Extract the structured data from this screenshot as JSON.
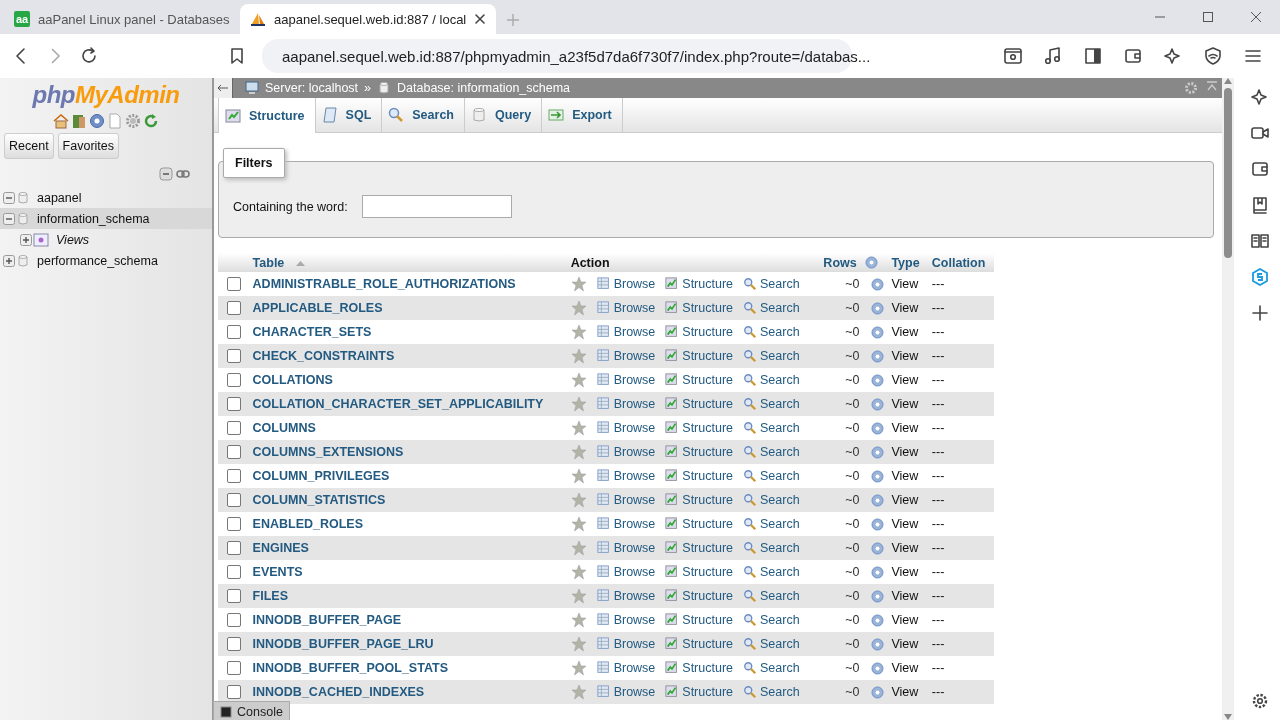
{
  "browser": {
    "tabs": [
      {
        "title": "aaPanel Linux panel - Databases",
        "icon_text": "aa",
        "selected": false
      },
      {
        "title": "aapanel.sequel.web.id:887 / local",
        "selected": true
      }
    ],
    "address": "aapanel.sequel.web.id:887/phpmyadmin_a23f5d7da6f730f7/index.php?route=/databas..."
  },
  "nav": {
    "logo": [
      "php",
      "MyAdmin"
    ],
    "tabs": [
      {
        "label": "Recent"
      },
      {
        "label": "Favorites"
      }
    ],
    "tree": [
      {
        "label": "aapanel",
        "expanded": true,
        "selected": false,
        "italic": false
      },
      {
        "label": "information_schema",
        "expanded": true,
        "selected": true,
        "italic": false,
        "children": [
          {
            "label": "Views",
            "expanded": false,
            "selected": false,
            "italic": true
          }
        ]
      },
      {
        "label": "performance_schema",
        "expanded": false,
        "selected": false,
        "italic": false
      }
    ]
  },
  "breadcrumb": {
    "server": "Server: localhost",
    "separator": "»",
    "database": "Database: information_schema"
  },
  "tabs": [
    {
      "label": "Structure",
      "selected": true
    },
    {
      "label": "SQL",
      "selected": false
    },
    {
      "label": "Search",
      "selected": false
    },
    {
      "label": "Query",
      "selected": false
    },
    {
      "label": "Export",
      "selected": false
    }
  ],
  "filters": {
    "legend": "Filters",
    "label": "Containing the word:"
  },
  "table": {
    "columns": [
      "Table",
      "Action",
      "Rows",
      "Type",
      "Collation"
    ],
    "rows": [
      {
        "name": "ADMINISTRABLE_ROLE_AUTHORIZATIONS",
        "checked": false,
        "favorite": false,
        "actions": [
          "Browse",
          "Structure",
          "Search"
        ],
        "rows": "~0",
        "type": "View",
        "collation": "---"
      },
      {
        "name": "APPLICABLE_ROLES",
        "checked": false,
        "favorite": false,
        "actions": [
          "Browse",
          "Structure",
          "Search"
        ],
        "rows": "~0",
        "type": "View",
        "collation": "---"
      },
      {
        "name": "CHARACTER_SETS",
        "checked": false,
        "favorite": false,
        "actions": [
          "Browse",
          "Structure",
          "Search"
        ],
        "rows": "~0",
        "type": "View",
        "collation": "---"
      },
      {
        "name": "CHECK_CONSTRAINTS",
        "checked": false,
        "favorite": false,
        "actions": [
          "Browse",
          "Structure",
          "Search"
        ],
        "rows": "~0",
        "type": "View",
        "collation": "---"
      },
      {
        "name": "COLLATIONS",
        "checked": false,
        "favorite": false,
        "actions": [
          "Browse",
          "Structure",
          "Search"
        ],
        "rows": "~0",
        "type": "View",
        "collation": "---"
      },
      {
        "name": "COLLATION_CHARACTER_SET_APPLICABILITY",
        "checked": false,
        "favorite": false,
        "actions": [
          "Browse",
          "Structure",
          "Search"
        ],
        "rows": "~0",
        "type": "View",
        "collation": "---"
      },
      {
        "name": "COLUMNS",
        "checked": false,
        "favorite": false,
        "actions": [
          "Browse",
          "Structure",
          "Search"
        ],
        "rows": "~0",
        "type": "View",
        "collation": "---"
      },
      {
        "name": "COLUMNS_EXTENSIONS",
        "checked": false,
        "favorite": false,
        "actions": [
          "Browse",
          "Structure",
          "Search"
        ],
        "rows": "~0",
        "type": "View",
        "collation": "---"
      },
      {
        "name": "COLUMN_PRIVILEGES",
        "checked": false,
        "favorite": false,
        "actions": [
          "Browse",
          "Structure",
          "Search"
        ],
        "rows": "~0",
        "type": "View",
        "collation": "---"
      },
      {
        "name": "COLUMN_STATISTICS",
        "checked": false,
        "favorite": false,
        "actions": [
          "Browse",
          "Structure",
          "Search"
        ],
        "rows": "~0",
        "type": "View",
        "collation": "---"
      },
      {
        "name": "ENABLED_ROLES",
        "checked": false,
        "favorite": false,
        "actions": [
          "Browse",
          "Structure",
          "Search"
        ],
        "rows": "~0",
        "type": "View",
        "collation": "---"
      },
      {
        "name": "ENGINES",
        "checked": false,
        "favorite": false,
        "actions": [
          "Browse",
          "Structure",
          "Search"
        ],
        "rows": "~0",
        "type": "View",
        "collation": "---"
      },
      {
        "name": "EVENTS",
        "checked": false,
        "favorite": false,
        "actions": [
          "Browse",
          "Structure",
          "Search"
        ],
        "rows": "~0",
        "type": "View",
        "collation": "---"
      },
      {
        "name": "FILES",
        "checked": false,
        "favorite": false,
        "actions": [
          "Browse",
          "Structure",
          "Search"
        ],
        "rows": "~0",
        "type": "View",
        "collation": "---"
      },
      {
        "name": "INNODB_BUFFER_PAGE",
        "checked": false,
        "favorite": false,
        "actions": [
          "Browse",
          "Structure",
          "Search"
        ],
        "rows": "~0",
        "type": "View",
        "collation": "---"
      },
      {
        "name": "INNODB_BUFFER_PAGE_LRU",
        "checked": false,
        "favorite": false,
        "actions": [
          "Browse",
          "Structure",
          "Search"
        ],
        "rows": "~0",
        "type": "View",
        "collation": "---"
      },
      {
        "name": "INNODB_BUFFER_POOL_STATS",
        "checked": false,
        "favorite": false,
        "actions": [
          "Browse",
          "Structure",
          "Search"
        ],
        "rows": "~0",
        "type": "View",
        "collation": "---"
      },
      {
        "name": "INNODB_CACHED_INDEXES",
        "checked": false,
        "favorite": false,
        "actions": [
          "Browse",
          "Structure",
          "Search"
        ],
        "rows": "~0",
        "type": "View",
        "collation": "---"
      }
    ]
  },
  "console": {
    "label": "Console"
  }
}
